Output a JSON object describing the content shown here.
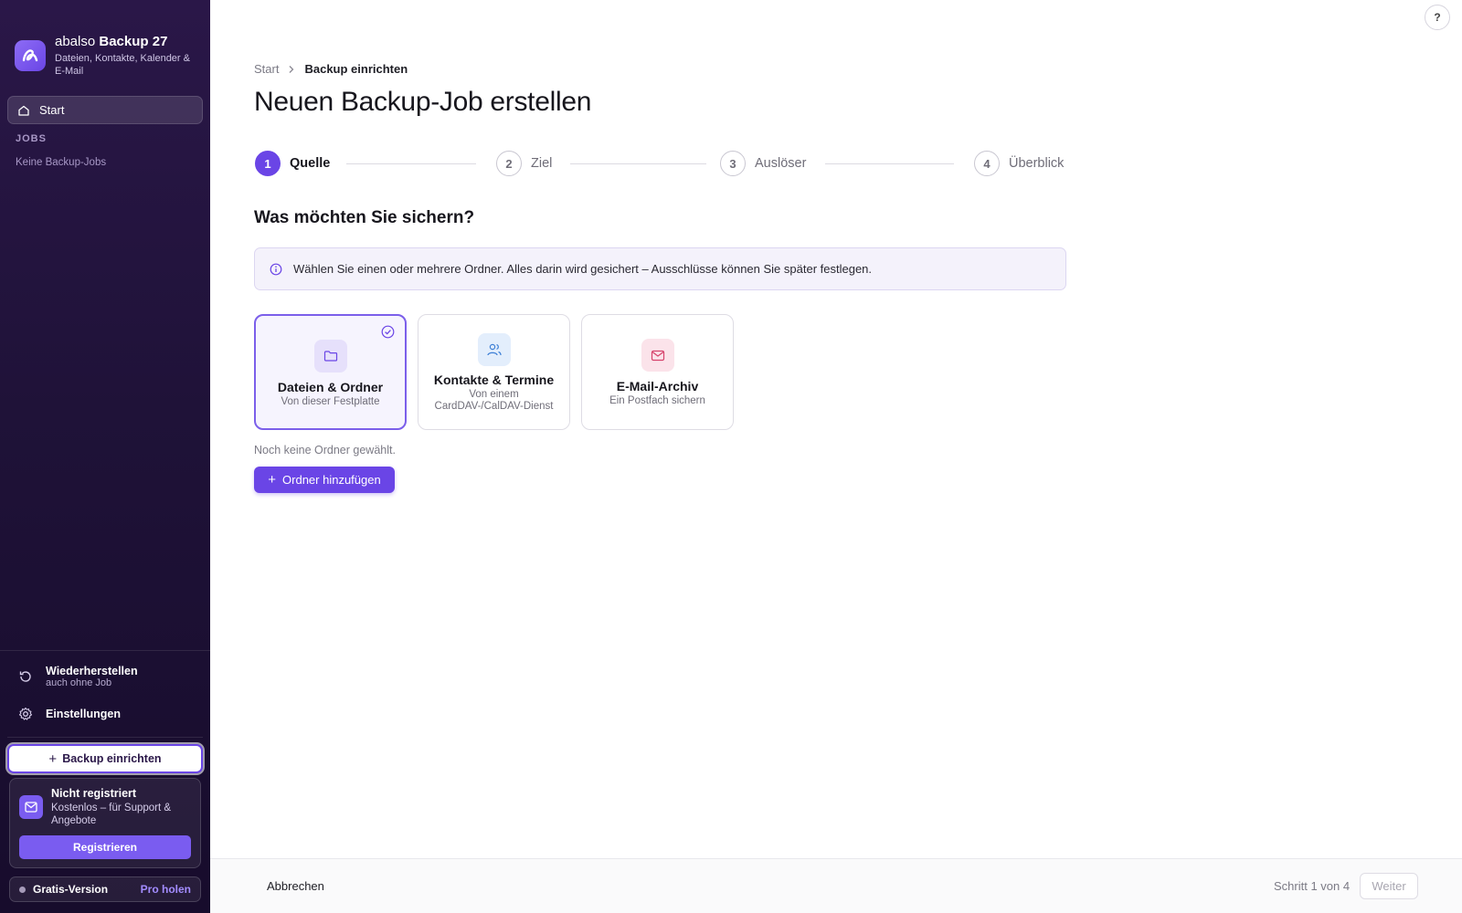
{
  "app": {
    "name_prefix": "abalso",
    "name_main": "Backup 27",
    "tagline": "Dateien, Kontakte, Kalender & E-Mail",
    "accent": "#6a45e6"
  },
  "sidebar": {
    "start_label": "Start",
    "jobs_heading": "JOBS",
    "jobs_empty": "Keine Backup-Jobs",
    "restore_label": "Wiederherstellen",
    "restore_sub": "auch ohne Job",
    "settings_label": "Einstellungen",
    "backup_button": "Backup einrichten",
    "register": {
      "title": "Nicht registriert",
      "subtitle": "Kostenlos – für Support & Angebote",
      "button": "Registrieren"
    },
    "version_label": "Gratis-Version",
    "pro_link": "Pro holen"
  },
  "header": {
    "help": "?",
    "breadcrumb": [
      "Start",
      "Backup einrichten"
    ],
    "title": "Neuen Backup-Job erstellen"
  },
  "stepper": {
    "steps": [
      {
        "num": "1",
        "label": "Quelle",
        "active": true
      },
      {
        "num": "2",
        "label": "Ziel",
        "active": false
      },
      {
        "num": "3",
        "label": "Auslöser",
        "active": false
      },
      {
        "num": "4",
        "label": "Überblick",
        "active": false
      }
    ]
  },
  "source": {
    "question": "Was möchten Sie sichern?",
    "info": "Wählen Sie einen oder mehrere Ordner. Alles darin wird gesichert – Ausschlüsse können Sie später festlegen.",
    "cards": [
      {
        "title": "Dateien & Ordner",
        "subtitle": "Von dieser Festplatte",
        "icon": "folder-icon",
        "selected": true
      },
      {
        "title": "Kontakte & Termine",
        "subtitle": "Von einem CardDAV-/CalDAV-Dienst",
        "icon": "users-icon",
        "selected": false
      },
      {
        "title": "E-Mail-Archiv",
        "subtitle": "Ein Postfach sichern",
        "icon": "mail-icon",
        "selected": false
      }
    ],
    "empty_text": "Noch keine Ordner gewählt.",
    "add_button": "Ordner hinzufügen"
  },
  "footer": {
    "cancel": "Abbrechen",
    "step_count": "Schritt 1 von 4",
    "next": "Weiter"
  }
}
